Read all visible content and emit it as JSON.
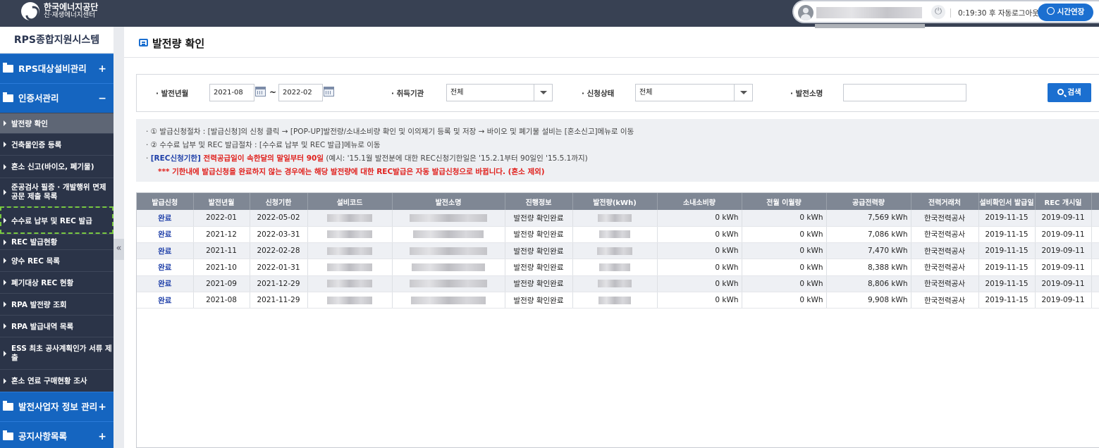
{
  "header": {
    "logo_line1": "한국에너지공단",
    "logo_line2": "신·재생에너지센터",
    "timer_text": "0:19:30 후 자동로그아웃",
    "extend_label": "시간연장"
  },
  "sidebar": {
    "title": "RPS종합지원시스템",
    "cat1": "RPS대상설비관리",
    "cat2": "인증서관리",
    "items": [
      "발전량 확인",
      "건축물인증 등록",
      "혼소 신고(바이오, 폐기물)",
      "준공검사 필증 · 개발행위 면제 공문 제출 목록",
      "수수료 납부 및 REC 발급",
      "REC 발급현황",
      "양수 REC 목록",
      "폐기대상 REC 현황",
      "RPA 발전량 조회",
      "RPA 발급내역 목록",
      "ESS 최초 공사계획인가 서류 제출",
      "혼소 연료 구매현황 조사"
    ],
    "cat3": "발전사업자 정보 관리",
    "cat4": "공지사항목록",
    "plus": "+",
    "minus": "−",
    "collapse": "«"
  },
  "page": {
    "title": "발전량 확인"
  },
  "search": {
    "period_label": "· 발전년월",
    "from": "2021-08",
    "tilde": "~",
    "to": "2022-02",
    "org_label": "· 취득기관",
    "org_value": "전체",
    "status_label": "· 신청상태",
    "status_value": "전체",
    "plant_label": "· 발전소명",
    "plant_value": "",
    "button": "검색"
  },
  "notice": {
    "line1": "· ① 발급신청절차 : [발급신청]의 신청 클릭 → [POP-UP]발전량/소내소비량 확인 및 이의제기 등록 및 저장 → 바이오 및 폐기물 설비는 [혼소신고]메뉴로 이동",
    "line2": "· ② 수수료 납부 및 REC 발급절차 : [수수료 납부 및 REC 발급]메뉴로 이동",
    "line3_prefix": "· ",
    "line3_blue": "[REC신청기한]",
    "line3_red": " 전력공급일이 속한달의 말일부터 90일",
    "line3_rest": " (예시: '15.1월 발전분에 대한 REC신청기한일은 '15.2.1부터 90일인 '15.5.1까지)",
    "line4": "*** 기한내에 발급신청을 완료하지 않는 경우에는 해당 발전량에 대한 REC발급은 자동 발급신청으로 바뀝니다. (혼소 제외)"
  },
  "table": {
    "headers": [
      "발급신청",
      "발전년월",
      "신청기한",
      "설비코드",
      "발전소명",
      "진행정보",
      "발전량(kWh)",
      "소내소비량",
      "전월 이월량",
      "공급전력량",
      "전력거래처",
      "설비확인서 발급일",
      "REC 개시일"
    ],
    "rows": [
      [
        "완료",
        "2022-01",
        "2022-05-02",
        "발전량 확인완료",
        "0 kWh",
        "0 kWh",
        "7,569 kWh",
        "한국전력공사",
        "2019-11-15",
        "2019-09-11"
      ],
      [
        "완료",
        "2021-12",
        "2022-03-31",
        "발전량 확인완료",
        "0 kWh",
        "0 kWh",
        "7,086 kWh",
        "한국전력공사",
        "2019-11-15",
        "2019-09-11"
      ],
      [
        "완료",
        "2021-11",
        "2022-02-28",
        "발전량 확인완료",
        "0 kWh",
        "0 kWh",
        "7,470 kWh",
        "한국전력공사",
        "2019-11-15",
        "2019-09-11"
      ],
      [
        "완료",
        "2021-10",
        "2022-01-31",
        "발전량 확인완료",
        "0 kWh",
        "0 kWh",
        "8,388 kWh",
        "한국전력공사",
        "2019-11-15",
        "2019-09-11"
      ],
      [
        "완료",
        "2021-09",
        "2021-12-29",
        "발전량 확인완료",
        "0 kWh",
        "0 kWh",
        "8,806 kWh",
        "한국전력공사",
        "2019-11-15",
        "2019-09-11"
      ],
      [
        "완료",
        "2021-08",
        "2021-11-29",
        "발전량 확인완료",
        "0 kWh",
        "0 kWh",
        "9,908 kWh",
        "한국전력공사",
        "2019-11-15",
        "2019-09-11"
      ]
    ]
  },
  "colors": {
    "topbar": "#384153",
    "primary": "#1b6fd0",
    "sidebar_cat": "#1565c0",
    "sidebar_bg": "#2b3448",
    "alert": "#e0201c",
    "notice_blue": "#1e3fa8"
  }
}
